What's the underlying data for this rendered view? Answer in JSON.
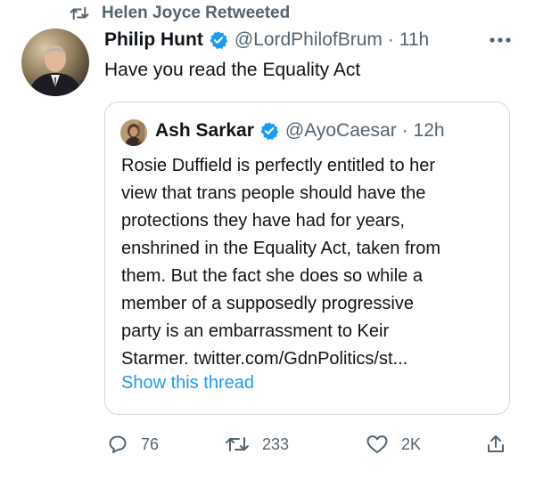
{
  "retweet_header": {
    "text": "Helen Joyce Retweeted"
  },
  "tweet": {
    "author_name": "Philip Hunt",
    "handle": "@LordPhilofBrum",
    "time": "· 11h",
    "text": "Have you read the Equality Act"
  },
  "quote": {
    "author_name": "Ash Sarkar",
    "handle": "@AyoCaesar",
    "time": "· 12h",
    "lines": [
      "Rosie Duffield is perfectly entitled to her",
      "view that trans people should have the",
      "protections they have had for years,",
      "enshrined in the Equality Act, taken from",
      "them. But the fact she does so while a",
      "member of a supposedly progressive",
      "party is an embarrassment to Keir",
      "Starmer. twitter.com/GdnPolitics/st..."
    ],
    "show_thread": "Show this thread"
  },
  "actions": {
    "reply_count": "76",
    "retweet_count": "233",
    "like_count": "2K"
  },
  "colors": {
    "accent": "#1d9bf0",
    "muted": "#536471",
    "border": "#cfd9de"
  },
  "icons": {
    "retweet_header": "retweet-icon",
    "verified": "verified-badge-icon",
    "more": "more-dots-icon",
    "reply": "reply-icon",
    "retweet": "retweet-icon",
    "like": "heart-icon",
    "share": "share-icon"
  }
}
